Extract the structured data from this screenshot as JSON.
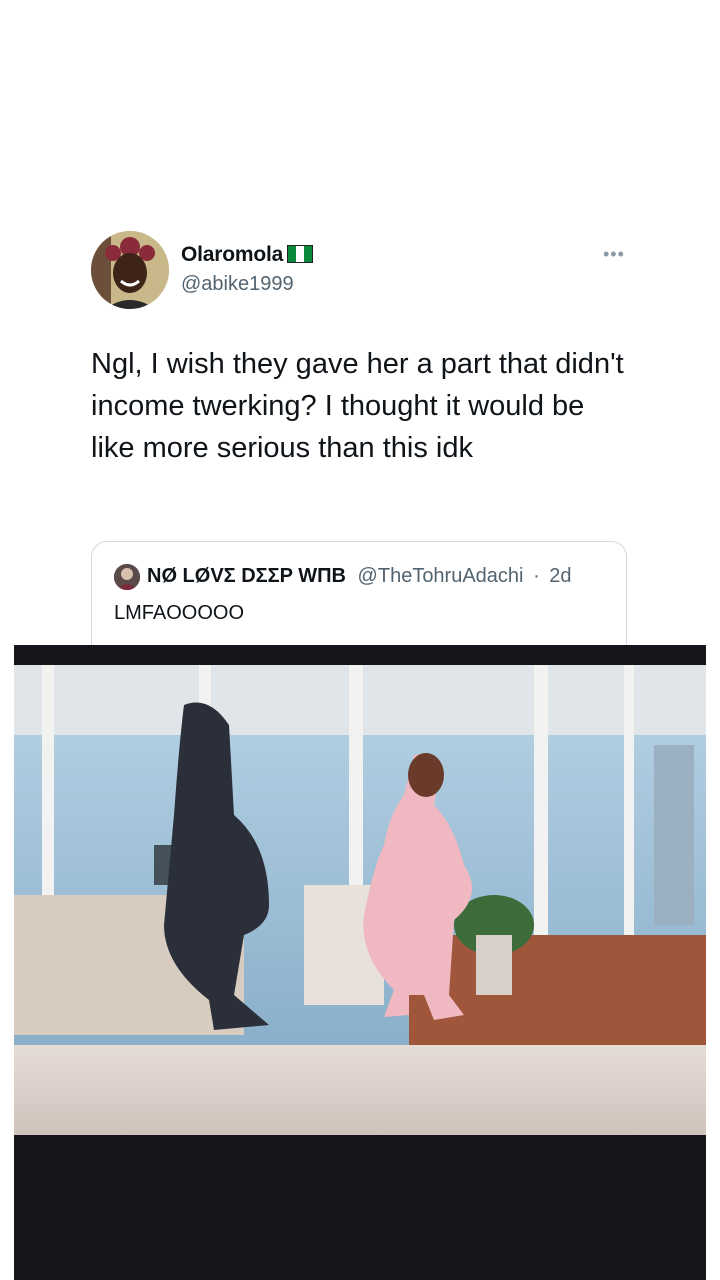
{
  "tweet": {
    "display_name": "Olaromola",
    "flag_icon": "nigeria-flag-icon",
    "handle": "@abike1999",
    "more_icon": "more-horizontal-icon",
    "text": "Ngl, I wish they gave her a part that didn't income twerking? I thought it would be like more serious than this idk"
  },
  "quoted_tweet": {
    "display_name": "NØ LØVΣ DΣΣP WΠB",
    "handle": "@TheTohruAdachi",
    "separator": "·",
    "time": "2d",
    "text": "LMFAOOOOO"
  },
  "media": {
    "type": "video-still",
    "description_icon": "video-frame"
  },
  "colors": {
    "text_primary": "#0f1419",
    "text_secondary": "#536471",
    "border": "#cfd9de",
    "video_bg": "#15151b"
  }
}
